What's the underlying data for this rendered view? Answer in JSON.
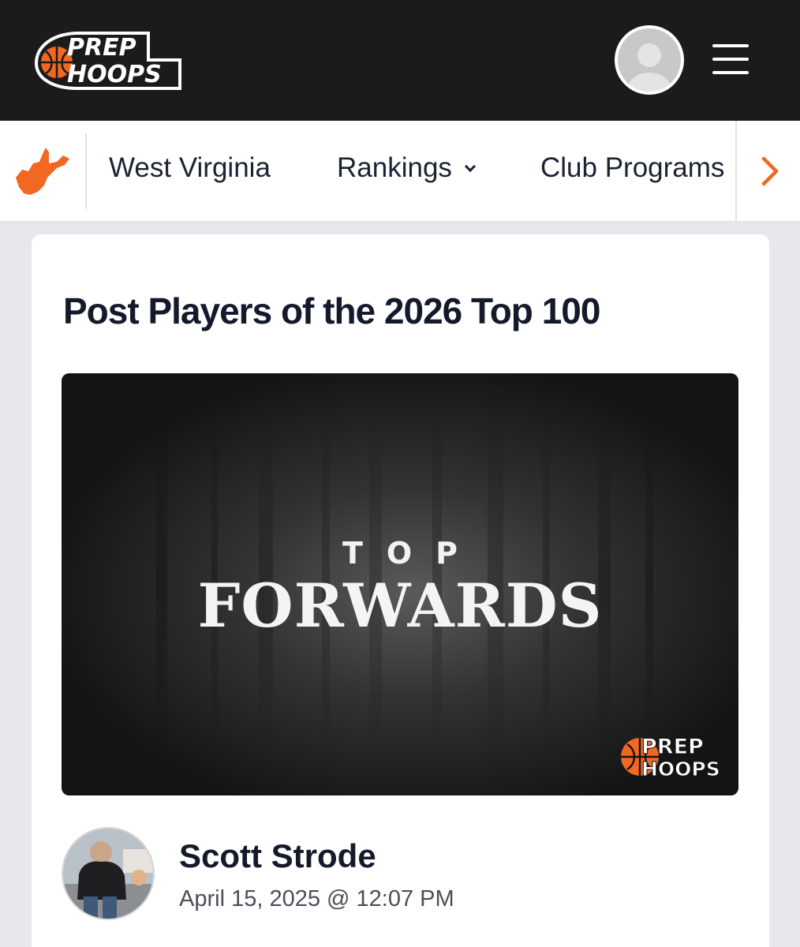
{
  "header": {
    "logo_line1": "PREP",
    "logo_line2": "HOOPS",
    "logo_icon": "basketball-icon",
    "profile_icon": "user-avatar-icon",
    "menu_icon": "hamburger-menu-icon"
  },
  "nav": {
    "state_icon": "west-virginia-map-icon",
    "items": [
      {
        "label": "West Virginia"
      },
      {
        "label": "Rankings"
      },
      {
        "label": "Club Programs"
      }
    ],
    "next_icon": "chevron-right-icon"
  },
  "article": {
    "title": "Post Players of the 2026 Top 100",
    "hero": {
      "line1": "TOP",
      "line2": "FORWARDS",
      "logo_line1": "PREP",
      "logo_line2": "HOOPS"
    },
    "author": {
      "name": "Scott Strode",
      "date": "April 15, 2025 @ 12:07 PM"
    }
  },
  "colors": {
    "brand_orange": "#f26722",
    "header_bg": "#1b1b1b",
    "page_bg": "#e7e8ec",
    "text_dark": "#141a2b"
  }
}
